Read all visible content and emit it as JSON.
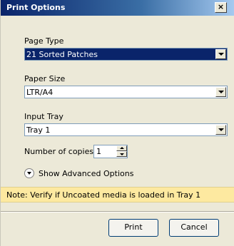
{
  "window": {
    "title": "Print Options",
    "close_label": "×"
  },
  "page_type": {
    "label": "Page Type",
    "value": "21 Sorted Patches"
  },
  "paper_size": {
    "label": "Paper Size",
    "value": "LTR/A4"
  },
  "input_tray": {
    "label": "Input Tray",
    "value": "Tray 1"
  },
  "copies": {
    "label": "Number of copies:",
    "value": "1"
  },
  "advanced": {
    "label": "Show Advanced Options"
  },
  "note": {
    "text": "Note: Verify if Uncoated media is loaded in Tray 1"
  },
  "buttons": {
    "print": "Print",
    "cancel": "Cancel"
  },
  "colors": {
    "title_bar": "#0a246a",
    "selected": "#0a246a",
    "note_bg": "#fde9a0"
  }
}
